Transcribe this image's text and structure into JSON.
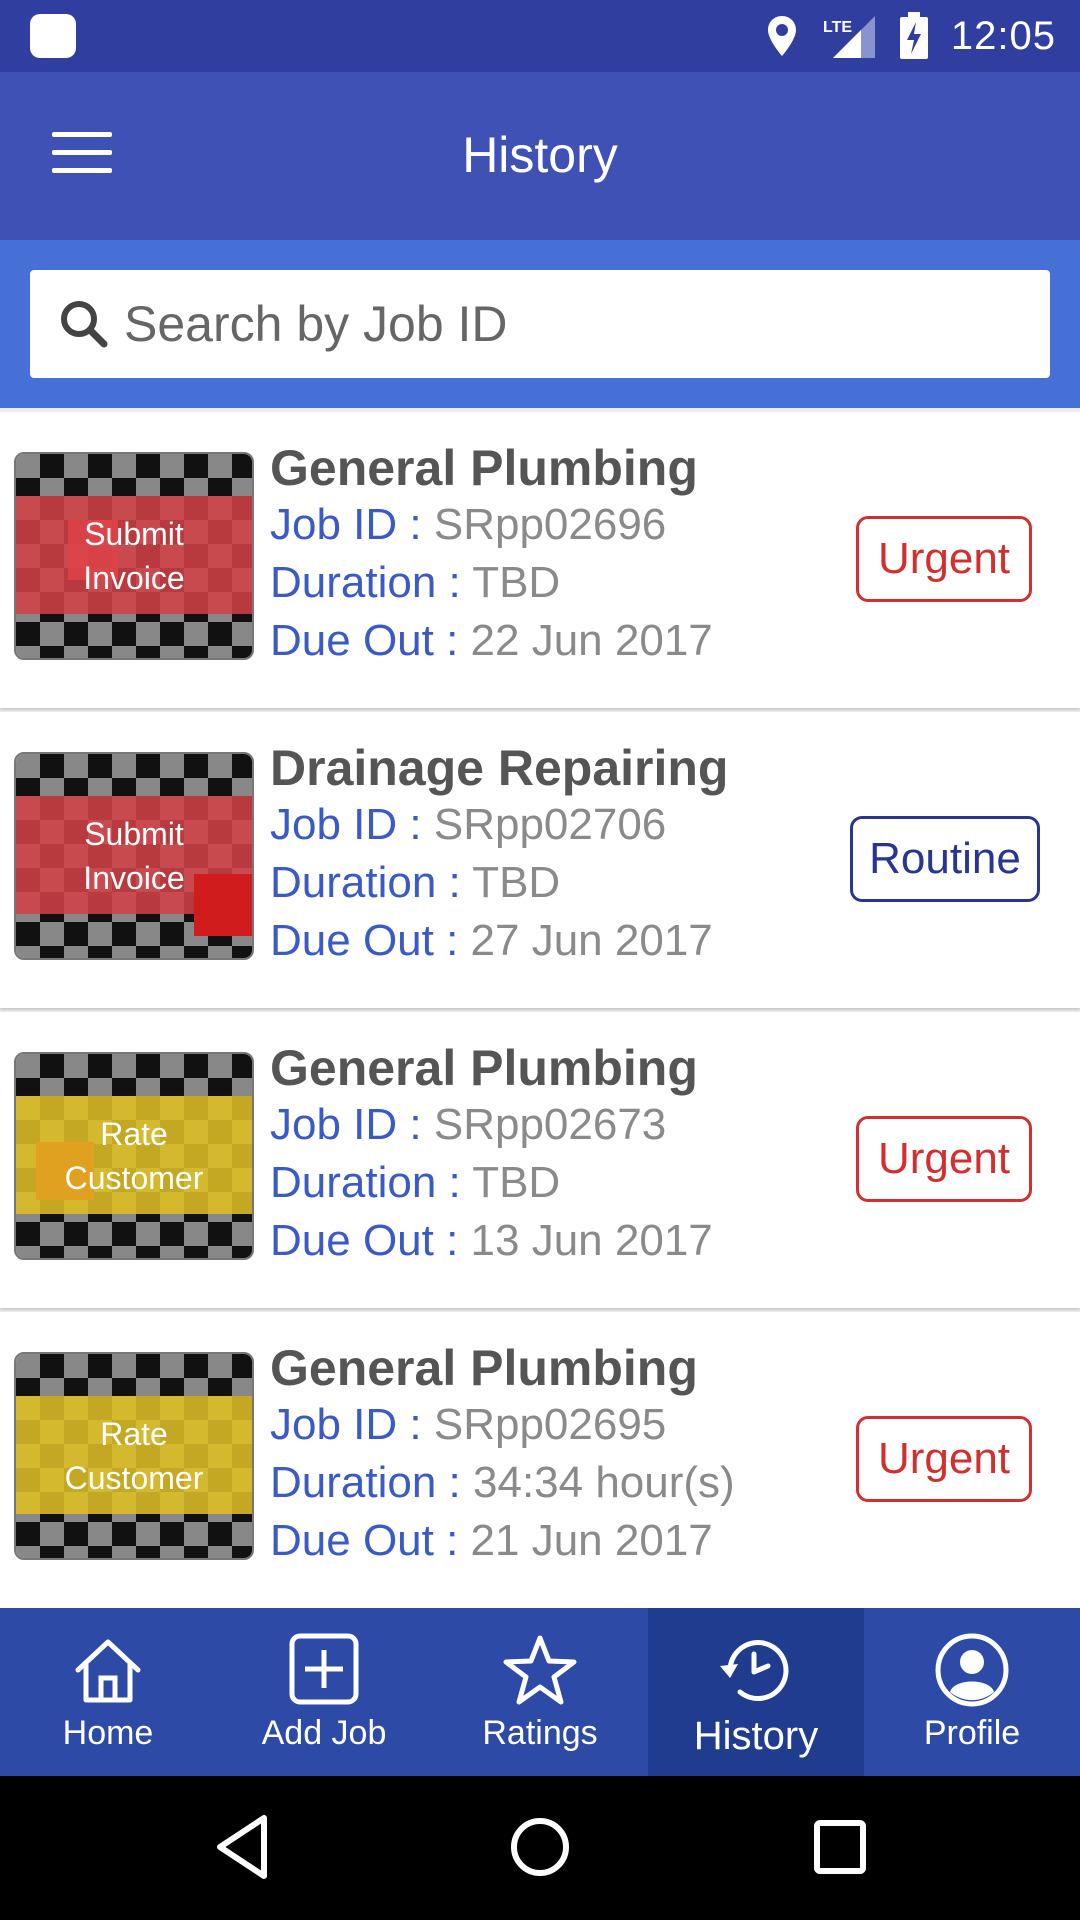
{
  "status_bar": {
    "time": "12:05",
    "network": "LTE",
    "icons": [
      "app-icon",
      "location-icon",
      "signal-icon",
      "battery-charging-icon"
    ]
  },
  "app_bar": {
    "title": "History",
    "menu_icon": "hamburger-menu-icon"
  },
  "search": {
    "placeholder": "Search by Job ID",
    "icon": "search-icon"
  },
  "labels": {
    "job_id": "Job ID :",
    "duration": "Duration :",
    "due_out": "Due Out :"
  },
  "jobs": [
    {
      "title": "General Plumbing",
      "job_id": "SRpp02696",
      "duration": "TBD",
      "due_out": "22 Jun 2017",
      "priority": "Urgent",
      "action_line1": "Submit",
      "action_line2": "Invoice",
      "thumb_color": "red"
    },
    {
      "title": "Drainage Repairing",
      "job_id": "SRpp02706",
      "duration": "TBD",
      "due_out": "27 Jun 2017",
      "priority": "Routine",
      "action_line1": "Submit",
      "action_line2": "Invoice",
      "thumb_color": "red"
    },
    {
      "title": "General Plumbing",
      "job_id": "SRpp02673",
      "duration": "TBD",
      "due_out": "13 Jun 2017",
      "priority": "Urgent",
      "action_line1": "Rate",
      "action_line2": "Customer",
      "thumb_color": "yellow"
    },
    {
      "title": "General Plumbing",
      "job_id": "SRpp02695",
      "duration": "34:34 hour(s)",
      "due_out": "21 Jun 2017",
      "priority": "Urgent",
      "action_line1": "Rate",
      "action_line2": "Customer",
      "thumb_color": "yellow"
    }
  ],
  "bottom_nav": [
    {
      "label": "Home",
      "icon": "home-icon"
    },
    {
      "label": "Add Job",
      "icon": "add-box-icon"
    },
    {
      "label": "Ratings",
      "icon": "star-icon"
    },
    {
      "label": "History",
      "icon": "history-clock-icon",
      "active": true
    },
    {
      "label": "Profile",
      "icon": "profile-icon"
    }
  ],
  "system_nav": [
    "back-icon",
    "home-circle-icon",
    "recents-icon"
  ],
  "colors": {
    "status_bar": "#303f9f",
    "app_bar": "#3f51b5",
    "search_panel": "#4670d6",
    "key_text": "#3a5bc7",
    "urgent": "#d32f2f",
    "routine": "#283593",
    "bottom_nav": "#2d4aa6"
  }
}
